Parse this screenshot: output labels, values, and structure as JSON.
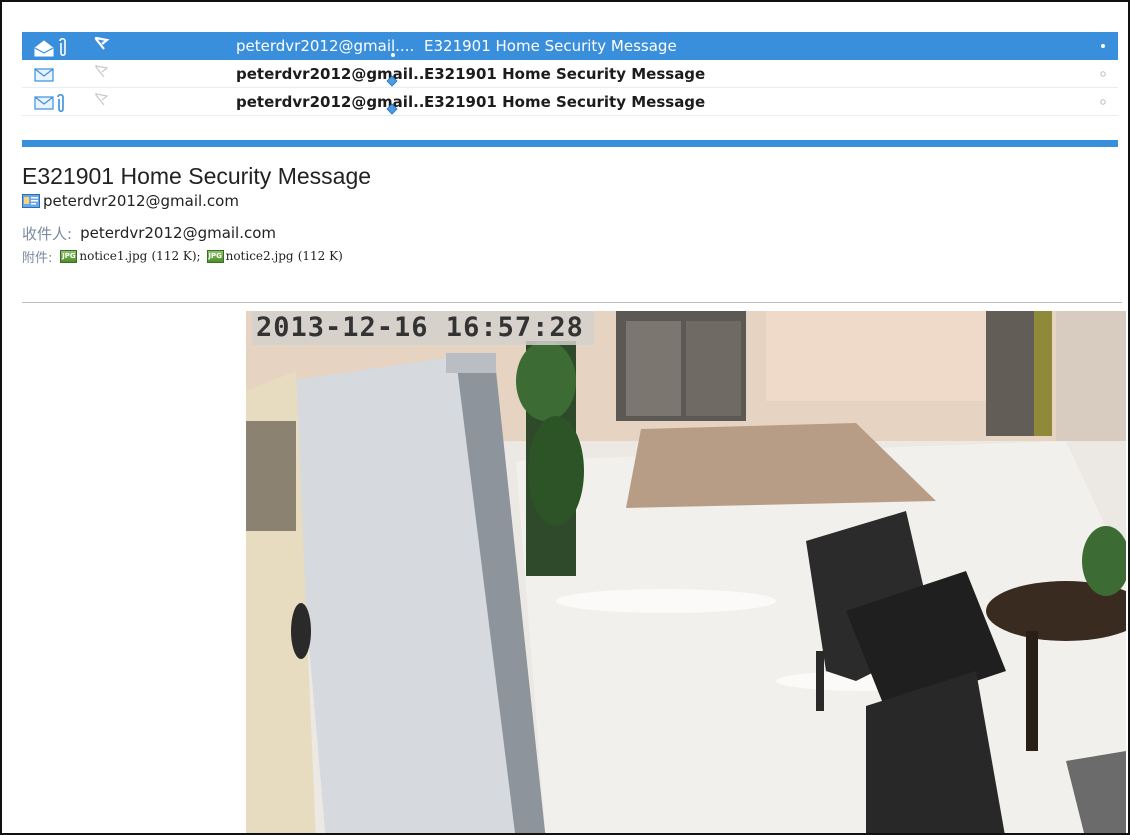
{
  "message_list": [
    {
      "from": "peterdvr2012@gmail....",
      "subject": "E321901 Home Security Message",
      "selected": true,
      "has_attachment": true,
      "read": true,
      "flagged": true
    },
    {
      "from": "peterdvr2012@gmail...",
      "subject": "E321901 Home Security Message",
      "selected": false,
      "has_attachment": false,
      "read": false,
      "flagged": false
    },
    {
      "from": "peterdvr2012@gmail...",
      "subject": "E321901 Home Security Message",
      "selected": false,
      "has_attachment": true,
      "read": false,
      "flagged": false
    }
  ],
  "reading": {
    "subject": "E321901 Home Security Message",
    "sender": "peterdvr2012@gmail.com",
    "to_label": "收件人:",
    "to": "peterdvr2012@gmail.com",
    "attachments_label": "附件:",
    "attachments": [
      {
        "name": "notice1.jpg",
        "size": "(112 K);"
      },
      {
        "name": "notice2.jpg",
        "size": "(112 K)"
      }
    ],
    "jpg_icon_text": "JPG"
  },
  "camera": {
    "timestamp": "2013-12-16 16:57:28"
  },
  "colors": {
    "selection": "#3a8fdc",
    "label": "#7a8aa0"
  }
}
